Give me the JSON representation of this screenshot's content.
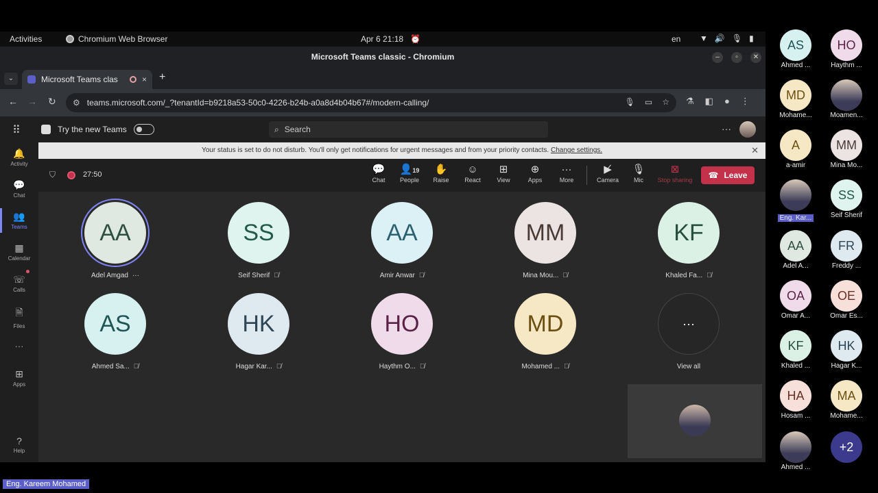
{
  "os_bar": {
    "activities": "Activities",
    "app_name": "Chromium Web Browser",
    "datetime": "Apr 6  21:18",
    "lang": "en"
  },
  "window": {
    "title": "Microsoft Teams classic - Chromium"
  },
  "tab": {
    "label": "Microsoft Teams clas",
    "close": "×",
    "new": "+"
  },
  "address": {
    "url": "teams.microsoft.com/_?tenantId=b9218a53-50c0-4226-b24b-a0a8d4b04b67#/modern-calling/"
  },
  "teams": {
    "try_new": "Try the new Teams",
    "search_placeholder": "Search",
    "more": "···",
    "rail": [
      {
        "label": "Activity",
        "icon": "bell-icon"
      },
      {
        "label": "Chat",
        "icon": "chat-icon"
      },
      {
        "label": "Teams",
        "icon": "teams-icon"
      },
      {
        "label": "Calendar",
        "icon": "calendar-icon"
      },
      {
        "label": "Calls",
        "icon": "phone-icon"
      },
      {
        "label": "Files",
        "icon": "file-icon"
      },
      {
        "label": "···",
        "icon": "more-icon"
      },
      {
        "label": "Apps",
        "icon": "apps-icon"
      },
      {
        "label": "Help",
        "icon": "help-icon"
      }
    ],
    "banner": {
      "text": "Your status is set to do not disturb. You'll only get notifications for urgent messages and from your priority contacts. ",
      "link": "Change settings."
    }
  },
  "meeting": {
    "timer": "27:50",
    "controls": [
      {
        "label": "Chat",
        "icon": "chat-icon"
      },
      {
        "label": "People",
        "icon": "people-icon",
        "count": "19"
      },
      {
        "label": "Raise",
        "icon": "hand-icon"
      },
      {
        "label": "React",
        "icon": "smile-icon"
      },
      {
        "label": "View",
        "icon": "grid-icon"
      },
      {
        "label": "Apps",
        "icon": "plus-square-icon"
      },
      {
        "label": "More",
        "icon": "more-icon"
      },
      {
        "label": "Camera",
        "icon": "camera-off-icon"
      },
      {
        "label": "Mic",
        "icon": "mic-icon"
      },
      {
        "label": "Stop sharing",
        "icon": "stop-share-icon"
      }
    ],
    "leave": "Leave",
    "tiles": [
      {
        "initials": "AA",
        "name": "Adel Amgad",
        "extra": "···",
        "bg": "#dfe9e1",
        "fg": "#2f4f3e"
      },
      {
        "initials": "SS",
        "name": "Seif Sherif",
        "bg": "#dff4ef",
        "fg": "#215a4a"
      },
      {
        "initials": "AA",
        "name": "Amir Anwar",
        "bg": "#dbf1f5",
        "fg": "#2c6071"
      },
      {
        "initials": "MM",
        "name": "Mina Mou...",
        "bg": "#ece4e2",
        "fg": "#4a3a36"
      },
      {
        "initials": "KF",
        "name": "Khaled Fa...",
        "bg": "#dcf1e6",
        "fg": "#264e3a"
      },
      {
        "initials": "AS",
        "name": "Ahmed Sa...",
        "bg": "#d7f0f0",
        "fg": "#215555"
      },
      {
        "initials": "HK",
        "name": "Hagar Kar...",
        "bg": "#dfeaf0",
        "fg": "#2e4556"
      },
      {
        "initials": "HO",
        "name": "Haythm O...",
        "bg": "#f0dbea",
        "fg": "#5a2247"
      },
      {
        "initials": "MD",
        "name": "Mohamed ...",
        "bg": "#f6e8c4",
        "fg": "#6b4f12"
      },
      {
        "initials": "···",
        "name": "View all"
      }
    ]
  },
  "gallery": [
    {
      "initials": "AS",
      "name": "Ahmed ...",
      "bg": "#d7f0f0",
      "fg": "#215555"
    },
    {
      "initials": "HO",
      "name": "Haythm ...",
      "bg": "#f0dbea",
      "fg": "#5a2247"
    },
    {
      "initials": "MD",
      "name": "Mohame...",
      "bg": "#f6e8c4",
      "fg": "#6b4f12"
    },
    {
      "initials": "",
      "name": "Moamen...",
      "photo": true
    },
    {
      "initials": "A",
      "name": "a-amir",
      "bg": "#f6e8c4",
      "fg": "#6b4f12"
    },
    {
      "initials": "MM",
      "name": "Mina Mo...",
      "bg": "#ece4e2",
      "fg": "#4a3a36"
    },
    {
      "initials": "",
      "name": "Eng. Kar...",
      "photo": true,
      "tag": true
    },
    {
      "initials": "SS",
      "name": "Seif Sherif",
      "bg": "#dff4ef",
      "fg": "#215a4a"
    },
    {
      "initials": "AA",
      "name": "Adel A...",
      "bg": "#dfe9e1",
      "fg": "#2f4f3e"
    },
    {
      "initials": "FR",
      "name": "Freddy ...",
      "bg": "#dfeaf0",
      "fg": "#2e4556"
    },
    {
      "initials": "OA",
      "name": "Omar A...",
      "bg": "#f0dbea",
      "fg": "#5a2247"
    },
    {
      "initials": "OE",
      "name": "Omar Es...",
      "bg": "#f7e0da",
      "fg": "#6a2f24"
    },
    {
      "initials": "KF",
      "name": "Khaled ...",
      "bg": "#dcf1e6",
      "fg": "#264e3a"
    },
    {
      "initials": "HK",
      "name": "Hagar K...",
      "bg": "#dfeaf0",
      "fg": "#2e4556"
    },
    {
      "initials": "HA",
      "name": "Hosam ...",
      "bg": "#f7e0da",
      "fg": "#6a2f24"
    },
    {
      "initials": "MA",
      "name": "Mohame...",
      "bg": "#f6e8c4",
      "fg": "#6b4f12"
    },
    {
      "initials": "",
      "name": "Ahmed ...",
      "photo": true
    },
    {
      "initials": "+2",
      "name": "",
      "bg": "#3b3a8c",
      "fg": "#ffffff"
    }
  ],
  "speaker_label": "Eng. Kareem Mohamed"
}
